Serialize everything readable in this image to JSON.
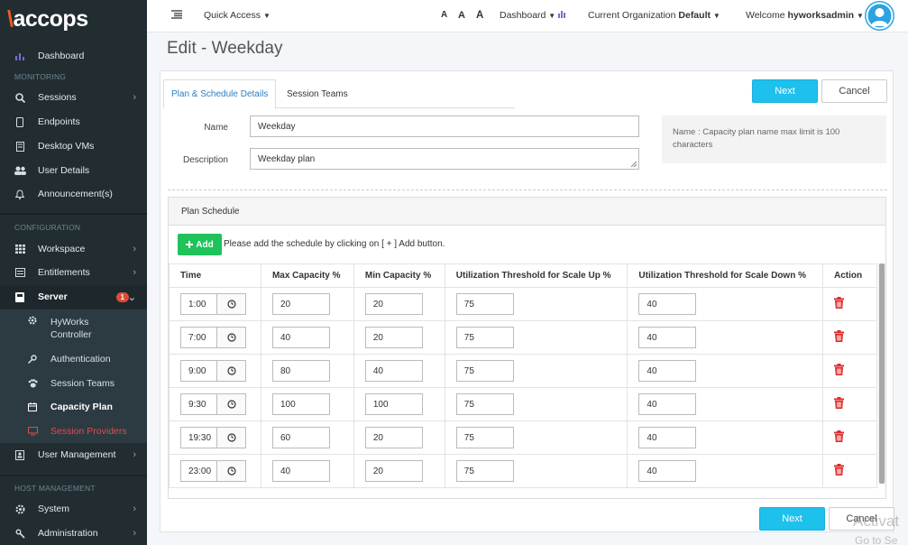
{
  "brand": {
    "logo": "accops"
  },
  "topbar": {
    "quick_access": "Quick Access",
    "font_a1": "A",
    "font_a2": "A",
    "font_a3": "A",
    "dashboard": "Dashboard",
    "org_label": "Current Organization",
    "org_value": "Default",
    "welcome": "Welcome",
    "user": "hyworksadmin"
  },
  "sidebar": {
    "dashboard": "Dashboard",
    "monitoring": "MONITORING",
    "sessions": "Sessions",
    "endpoints": "Endpoints",
    "desktop_vms": "Desktop VMs",
    "user_details": "User Details",
    "announcements": "Announcement(s)",
    "configuration": "CONFIGURATION",
    "workspace": "Workspace",
    "entitlements": "Entitlements",
    "server": "Server",
    "server_badge": "1",
    "hyworks_controller": "HyWorks Controller",
    "authentication": "Authentication",
    "session_teams": "Session Teams",
    "capacity_plan": "Capacity Plan",
    "session_providers": "Session Providers",
    "user_management": "User Management",
    "host_management": "HOST MANAGEMENT",
    "system": "System",
    "administration": "Administration"
  },
  "page": {
    "title": "Edit - Weekday",
    "tab_plan": "Plan & Schedule Details",
    "tab_teams": "Session Teams",
    "next": "Next",
    "cancel": "Cancel",
    "name_label": "Name",
    "name_value": "Weekday",
    "desc_label": "Description",
    "desc_value": "Weekday plan",
    "hint": "Name : Capacity plan name max limit is 100 characters"
  },
  "schedule": {
    "heading": "Plan Schedule",
    "add": "Add",
    "add_note": "Please add the schedule by clicking on [ + ] Add button.",
    "columns": [
      "Time",
      "Max Capacity %",
      "Min Capacity %",
      "Utilization Threshold for Scale Up %",
      "Utilization Threshold for Scale Down %",
      "Action"
    ],
    "rows": [
      {
        "time": "1:00",
        "max": "20",
        "min": "20",
        "up": "75",
        "down": "40"
      },
      {
        "time": "7:00",
        "max": "40",
        "min": "20",
        "up": "75",
        "down": "40"
      },
      {
        "time": "9:00",
        "max": "80",
        "min": "40",
        "up": "75",
        "down": "40"
      },
      {
        "time": "9:30",
        "max": "100",
        "min": "100",
        "up": "75",
        "down": "40"
      },
      {
        "time": "19:30",
        "max": "60",
        "min": "20",
        "up": "75",
        "down": "40"
      },
      {
        "time": "23:00",
        "max": "40",
        "min": "20",
        "up": "75",
        "down": "40"
      }
    ]
  },
  "footer": {
    "next": "Next",
    "cancel": "Cancel"
  },
  "watermark": {
    "line1": "Activat",
    "line2": "Go to Se"
  }
}
